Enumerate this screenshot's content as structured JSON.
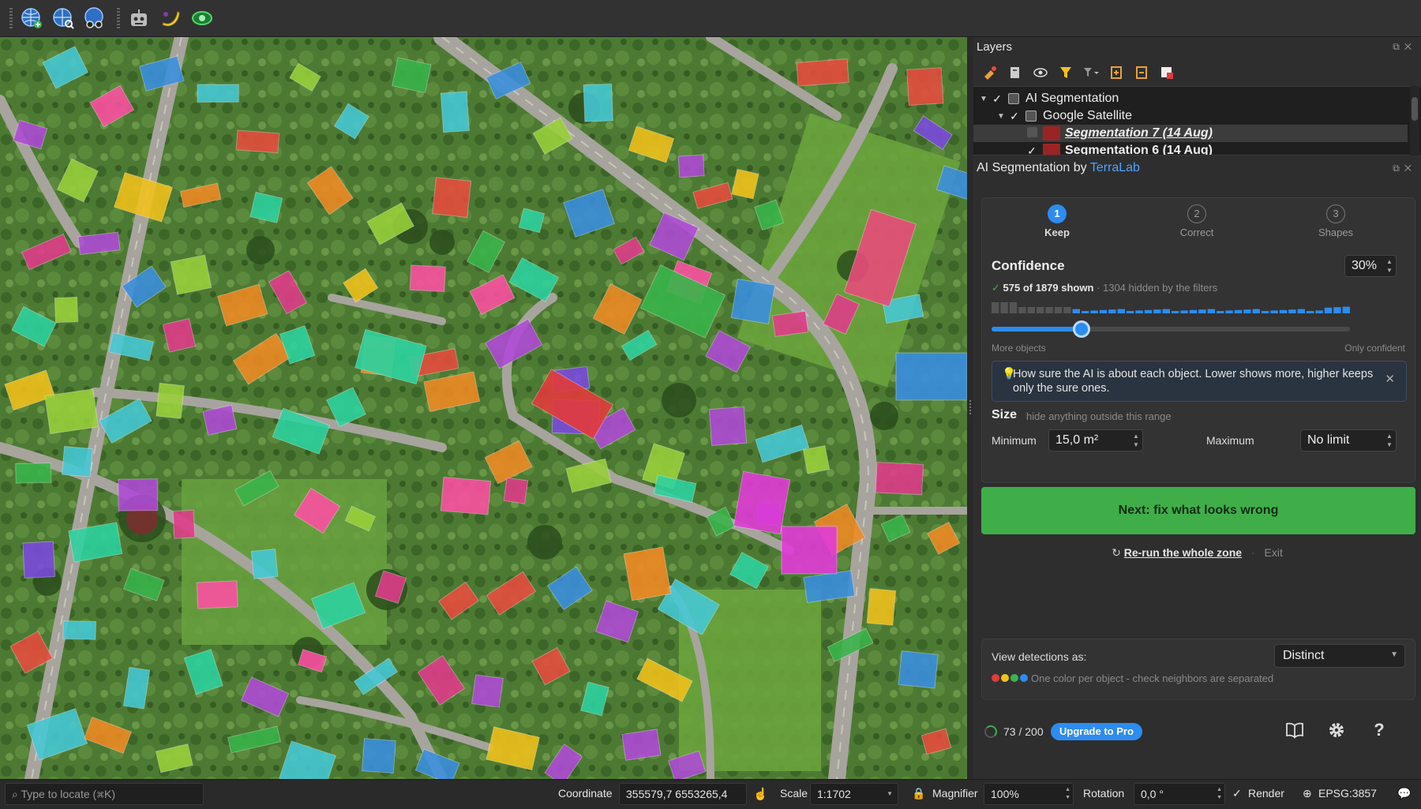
{
  "layers_panel": {
    "title": "Layers",
    "tree": [
      {
        "label": "AI Segmentation",
        "checked": true,
        "expanded": true
      },
      {
        "label": "Google Satellite",
        "checked": true,
        "expanded": true
      },
      {
        "label": "Segmentation 7 (14 Aug)",
        "checked": false,
        "selected": true
      },
      {
        "label": "Segmentation 6 (14 Aug)",
        "checked": true
      }
    ]
  },
  "plugin": {
    "title_prefix": "AI Segmentation by",
    "brand": "TerraLab",
    "brand_color": "#4da3ff",
    "steps": [
      {
        "num": "1",
        "label": "Keep",
        "active": true
      },
      {
        "num": "2",
        "label": "Correct"
      },
      {
        "num": "3",
        "label": "Shapes"
      }
    ],
    "confidence": {
      "label": "Confidence",
      "value": "30%",
      "value_fraction": 0.25,
      "shown_bold": "575 of 1879 shown",
      "hidden_text": "· 1304 hidden by the filters",
      "left_label": "More objects",
      "right_label": "Only confident"
    },
    "tip": {
      "text": "How sure the AI is about each object. Lower shows more, higher keeps only the sure ones."
    },
    "size": {
      "label": "Size",
      "hint": "hide anything outside this range",
      "min_label": "Minimum",
      "min_value": "15,0 m²",
      "max_label": "Maximum",
      "max_value": "No limit"
    },
    "next_button": "Next: fix what looks wrong",
    "rerun_link": "Re-run the whole zone",
    "exit_link": "Exit",
    "view": {
      "label": "View detections as:",
      "selected": "Distinct",
      "hint": "One color per object - check neighbors are separated",
      "dot_colors": [
        "#e23b3b",
        "#f2c21b",
        "#39b54a",
        "#2d8cf0"
      ]
    },
    "footer": {
      "quota": "73 / 200",
      "upgrade": "Upgrade to Pro"
    },
    "accent_color": "#2d8cf0",
    "primary_color": "#3fae49"
  },
  "statusbar": {
    "locate_placeholder": "Type to locate (⌘K)",
    "coordinate_label": "Coordinate",
    "coordinate_value": "355579,7  6553265,4",
    "scale_label": "Scale",
    "scale_value": "1:1702",
    "magnifier_label": "Magnifier",
    "magnifier_value": "100%",
    "rotation_label": "Rotation",
    "rotation_value": "0,0 °",
    "render_label": "Render",
    "crs": "EPSG:3857"
  }
}
